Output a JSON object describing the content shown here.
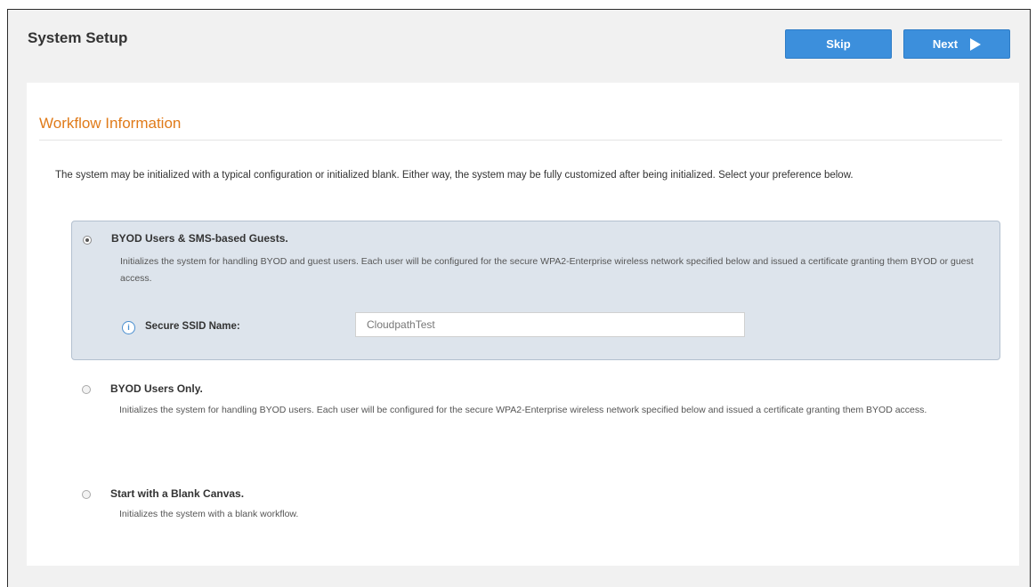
{
  "header": {
    "title": "System Setup",
    "skip_label": "Skip",
    "next_label": "Next"
  },
  "section": {
    "title": "Workflow Information",
    "intro": "The system may be initialized with a typical configuration or initialized blank. Either way, the system may be fully customized after being initialized. Select your preference below."
  },
  "options": [
    {
      "title": "BYOD Users & SMS-based Guests.",
      "description": "Initializes the system for handling BYOD and guest users. Each user will be configured for the secure WPA2-Enterprise wireless network specified below and issued a certificate granting them BYOD or guest access.",
      "selected": true
    },
    {
      "title": "BYOD Users Only.",
      "description": "Initializes the system for handling BYOD users. Each user will be configured for the secure WPA2-Enterprise wireless network specified below and issued a certificate granting them BYOD access.",
      "selected": false
    },
    {
      "title": "Start with a Blank Canvas.",
      "description": "Initializes the system with a blank workflow.",
      "selected": false
    }
  ],
  "ssid": {
    "label": "Secure SSID Name:",
    "value": "CloudpathTest",
    "info_icon": "i"
  },
  "colors": {
    "button": "#3c8fdc",
    "section_title": "#e07b1a",
    "selected_option_bg": "#dde4ec"
  },
  "icons": {
    "next": "play-icon",
    "ssid_info": "info-icon"
  }
}
